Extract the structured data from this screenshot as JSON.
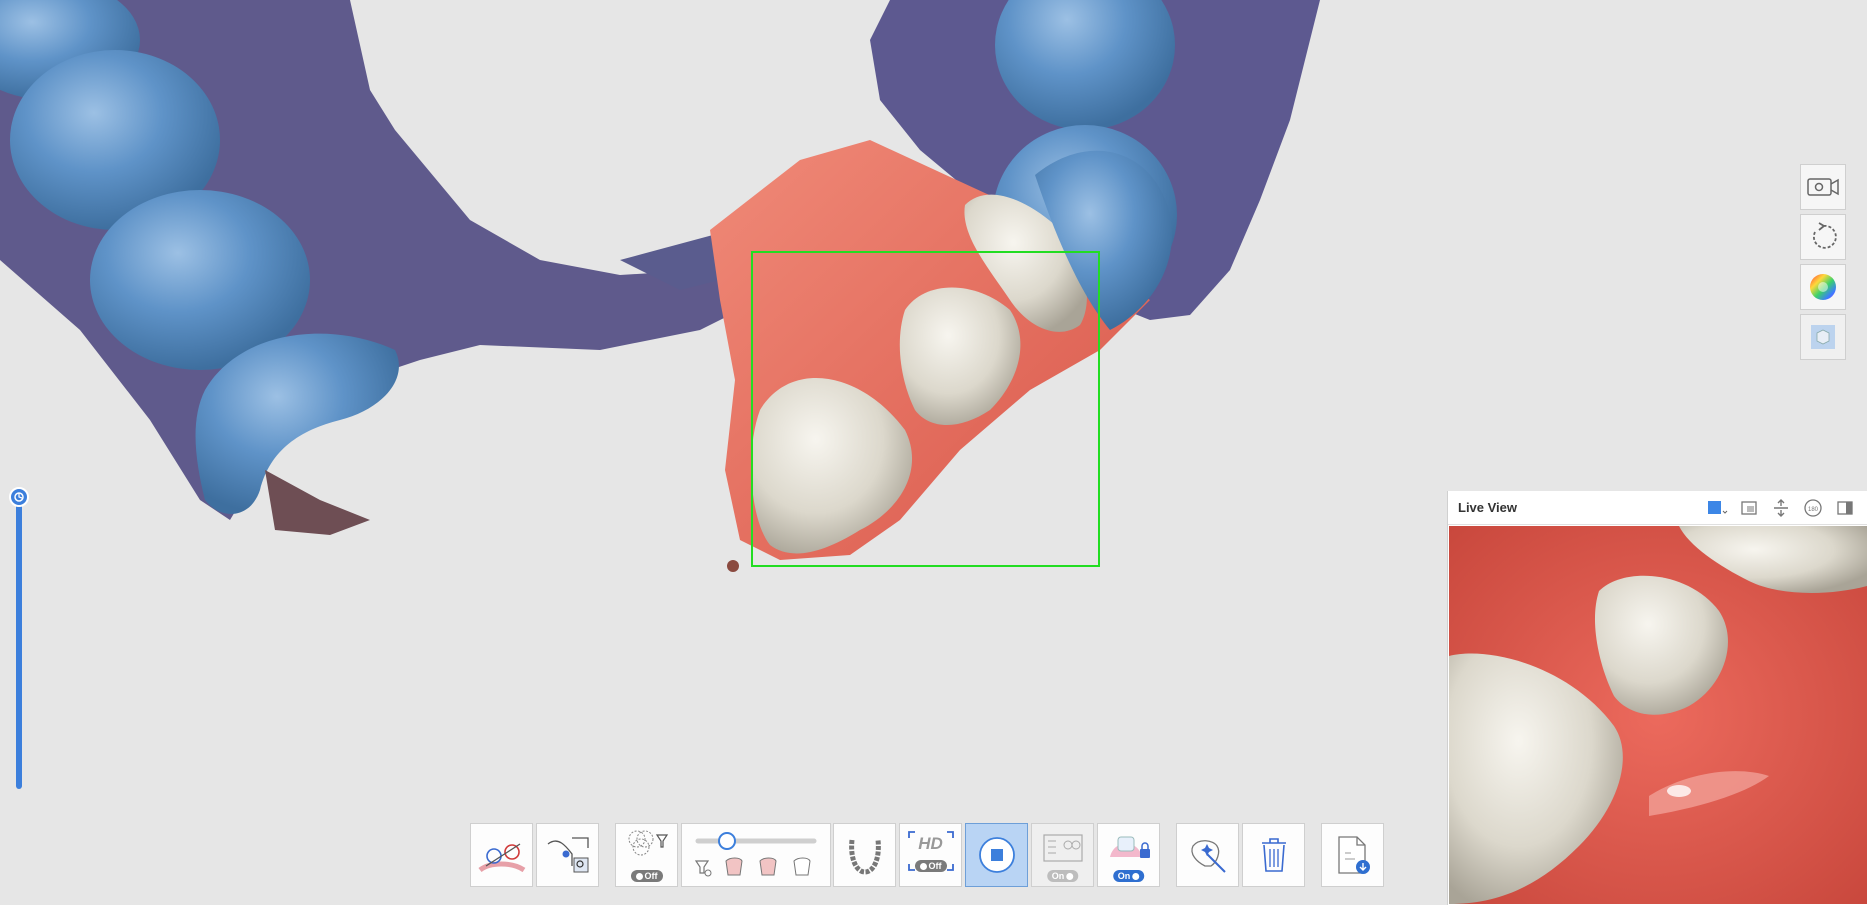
{
  "live_view": {
    "title": "Live View",
    "icons": [
      "color-square-icon",
      "layout-icon",
      "flip-vertical-icon",
      "rotate-180-icon",
      "panel-toggle-icon"
    ]
  },
  "right_toolbar": {
    "items": [
      {
        "name": "camera-icon"
      },
      {
        "name": "rotate-icon"
      },
      {
        "name": "color-wheel-icon"
      },
      {
        "name": "cube-icon"
      }
    ]
  },
  "bottom_toolbar": {
    "filter_toggle": "Off",
    "hd_label": "HD",
    "hd_toggle": "Off",
    "scan_mode_toggle": "On",
    "lock_toggle": "On",
    "stage_slider_level": 0.25
  },
  "colors": {
    "accent": "#3c7fdc",
    "scan_box": "#22dd22",
    "gum": "#e8705e",
    "tooth_scanned": "#5b8fc4",
    "tooth_raw": "#e9e6dc",
    "tissue": "#5f5a8c"
  }
}
